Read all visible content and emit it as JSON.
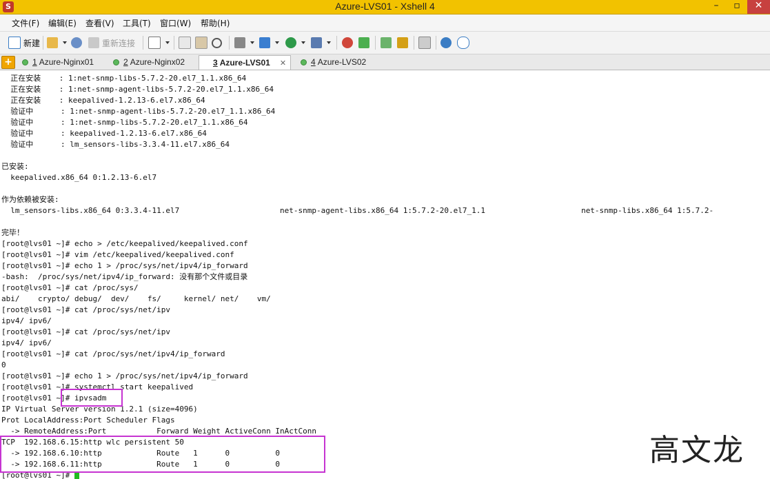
{
  "window": {
    "title": "Azure-LVS01 - Xshell 4",
    "app_icon": "xshell-icon"
  },
  "menu": [
    "文件(F)",
    "编辑(E)",
    "查看(V)",
    "工具(T)",
    "窗口(W)",
    "帮助(H)"
  ],
  "toolbar": {
    "new_label": "新建",
    "reconnect_label": "重新连接"
  },
  "tabs": [
    {
      "num": "1",
      "label": "Azure-Nginx01"
    },
    {
      "num": "2",
      "label": "Azure-Nginx02"
    },
    {
      "num": "3",
      "label": "Azure-LVS01",
      "active": true
    },
    {
      "num": "4",
      "label": "Azure-LVS02"
    }
  ],
  "terminal": {
    "lines": [
      "  正在安装    : 1:net-snmp-libs-5.7.2-20.el7_1.1.x86_64",
      "  正在安装    : 1:net-snmp-agent-libs-5.7.2-20.el7_1.1.x86_64",
      "  正在安装    : keepalived-1.2.13-6.el7.x86_64",
      "  验证中      : 1:net-snmp-agent-libs-5.7.2-20.el7_1.1.x86_64",
      "  验证中      : 1:net-snmp-libs-5.7.2-20.el7_1.1.x86_64",
      "  验证中      : keepalived-1.2.13-6.el7.x86_64",
      "  验证中      : lm_sensors-libs-3.3.4-11.el7.x86_64",
      "",
      "已安装:",
      "  keepalived.x86_64 0:1.2.13-6.el7",
      "",
      "作为依赖被安装:",
      "  lm_sensors-libs.x86_64 0:3.3.4-11.el7                      net-snmp-agent-libs.x86_64 1:5.7.2-20.el7_1.1                     net-snmp-libs.x86_64 1:5.7.2-",
      "",
      "完毕！",
      "[root@lvs01 ~]# echo > /etc/keepalived/keepalived.conf",
      "[root@lvs01 ~]# vim /etc/keepalived/keepalived.conf",
      "[root@lvs01 ~]# echo 1 > /proc/sys/net/ipv4/ip_forward",
      "-bash:  /proc/sys/net/ipv4/ip_forward: 没有那个文件或目录",
      "[root@lvs01 ~]# cat /proc/sys/",
      "abi/    crypto/ debug/  dev/    fs/     kernel/ net/    vm/",
      "[root@lvs01 ~]# cat /proc/sys/net/ipv",
      "ipv4/ ipv6/",
      "[root@lvs01 ~]# cat /proc/sys/net/ipv",
      "ipv4/ ipv6/",
      "[root@lvs01 ~]# cat /proc/sys/net/ipv4/ip_forward",
      "0",
      "[root@lvs01 ~]# echo 1 > /proc/sys/net/ipv4/ip_forward",
      "[root@lvs01 ~]# systemctl start keepalived",
      "[root@lvs01 ~]# ipvsadm",
      "IP Virtual Server version 1.2.1 (size=4096)",
      "Prot LocalAddress:Port Scheduler Flags",
      "  -> RemoteAddress:Port           Forward Weight ActiveConn InActConn",
      "TCP  192.168.6.15:http wlc persistent 50",
      "  -> 192.168.6.10:http            Route   1      0          0",
      "  -> 192.168.6.11:http            Route   1      0          0",
      "[root@lvs01 ~]# "
    ]
  },
  "watermark": "高文龙",
  "colors": {
    "titlebar": "#f2c200",
    "highlight": "#c633d1",
    "cursor": "#22bb22"
  }
}
